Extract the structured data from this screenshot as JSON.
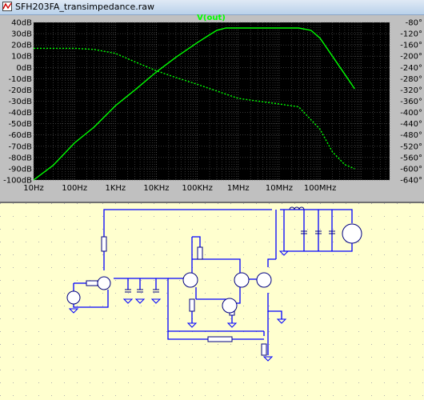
{
  "window": {
    "title": "SFH203FA_transimpedance.raw"
  },
  "colors": {
    "plot_background": "#000000",
    "trace": "#00ff00",
    "axis_text": "#000000",
    "schematic_background": "#ffffcf",
    "wire": "#0000ff",
    "component": "#000080",
    "component_label": "#000000"
  },
  "chart_data": {
    "type": "line",
    "title": "V(out)",
    "x_scale": "log",
    "xlim": [
      10,
      5000000000
    ],
    "x_ticks": [
      "10Hz",
      "100Hz",
      "1KHz",
      "10KHz",
      "100KHz",
      "1MHz",
      "10MHz",
      "100MHz"
    ],
    "x_tick_values": [
      10,
      100,
      1000,
      10000,
      100000,
      1000000,
      10000000,
      100000000
    ],
    "left_axis": {
      "ylim": [
        -100,
        40
      ],
      "ticks": [
        "40dB",
        "30dB",
        "20dB",
        "10dB",
        "0dB",
        "-10dB",
        "-20dB",
        "-30dB",
        "-40dB",
        "-50dB",
        "-60dB",
        "-70dB",
        "-80dB",
        "-90dB",
        "-100dB"
      ],
      "tick_values": [
        40,
        30,
        20,
        10,
        0,
        -10,
        -20,
        -30,
        -40,
        -50,
        -60,
        -70,
        -80,
        -90,
        -100
      ]
    },
    "right_axis": {
      "ylim": [
        -640,
        -80
      ],
      "ticks": [
        "-80°",
        "-120°",
        "-160°",
        "-200°",
        "-240°",
        "-280°",
        "-320°",
        "-360°",
        "-400°",
        "-440°",
        "-480°",
        "-520°",
        "-560°",
        "-600°",
        "-640°"
      ],
      "tick_values": [
        -80,
        -120,
        -160,
        -200,
        -240,
        -280,
        -320,
        -360,
        -400,
        -440,
        -480,
        -520,
        -560,
        -600,
        -640
      ]
    },
    "grid": true,
    "series": [
      {
        "line": "solid",
        "axis": "left",
        "x": [
          10,
          30,
          100,
          300,
          1000,
          3000,
          10000,
          30000,
          100000,
          200000,
          300000,
          500000,
          1000000,
          3000000,
          10000000,
          30000000,
          60000000,
          100000000,
          200000000,
          400000000,
          700000000
        ],
        "y": [
          -100,
          -87,
          -67,
          -53,
          -34,
          -20,
          -4,
          9,
          22,
          29,
          33,
          35,
          35,
          35,
          35,
          35,
          33,
          26,
          10,
          -6,
          -19
        ]
      },
      {
        "line": "dotted",
        "axis": "right",
        "x": [
          10,
          100,
          300,
          1000,
          3000,
          10000,
          30000,
          100000,
          1000000,
          10000000,
          30000000,
          100000000,
          200000000,
          400000000,
          700000000
        ],
        "y": [
          -172,
          -172,
          -176,
          -190,
          -220,
          -252,
          -276,
          -300,
          -350,
          -370,
          -380,
          -460,
          -540,
          -585,
          -600
        ]
      }
    ]
  }
}
